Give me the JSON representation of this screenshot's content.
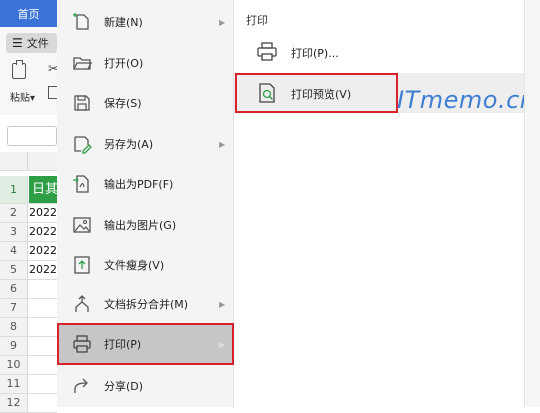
{
  "window": {
    "home_tab": "首页",
    "file_button": "文件",
    "paste_label": "粘贴"
  },
  "sheet": {
    "row_numbers": [
      "1",
      "2",
      "3",
      "4",
      "5",
      "6",
      "7",
      "8",
      "9",
      "10",
      "11",
      "12"
    ],
    "cells": [
      "日其",
      "2022",
      "2022",
      "2022",
      "2022",
      "",
      "",
      "",
      "",
      "",
      "",
      ""
    ]
  },
  "file_menu": {
    "items": [
      {
        "label": "新建(N)",
        "icon": "new-file-icon",
        "has_submenu": true
      },
      {
        "label": "打开(O)",
        "icon": "folder-icon",
        "has_submenu": false
      },
      {
        "label": "保存(S)",
        "icon": "save-icon",
        "has_submenu": false
      },
      {
        "label": "另存为(A)",
        "icon": "save-as-icon",
        "has_submenu": true
      },
      {
        "label": "输出为PDF(F)",
        "icon": "export-pdf-icon",
        "has_submenu": false
      },
      {
        "label": "输出为图片(G)",
        "icon": "export-image-icon",
        "has_submenu": false
      },
      {
        "label": "文件瘦身(V)",
        "icon": "slim-file-icon",
        "has_submenu": false
      },
      {
        "label": "文档拆分合并(M)",
        "icon": "split-merge-icon",
        "has_submenu": true
      },
      {
        "label": "打印(P)",
        "icon": "printer-icon",
        "has_submenu": true,
        "active": true
      },
      {
        "label": "分享(D)",
        "icon": "share-icon",
        "has_submenu": false
      }
    ]
  },
  "print_submenu": {
    "title": "打印",
    "items": [
      {
        "label": "打印(P)...",
        "icon": "printer-icon"
      },
      {
        "label": "打印预览(V)",
        "icon": "print-preview-icon",
        "hover": true
      }
    ]
  },
  "watermark": "ITmemo.cn",
  "colors": {
    "accent": "#3b73d9",
    "highlight_border": "#d8222a",
    "sheet_header": "#2e9e47",
    "watermark": "#3f7fd3"
  }
}
